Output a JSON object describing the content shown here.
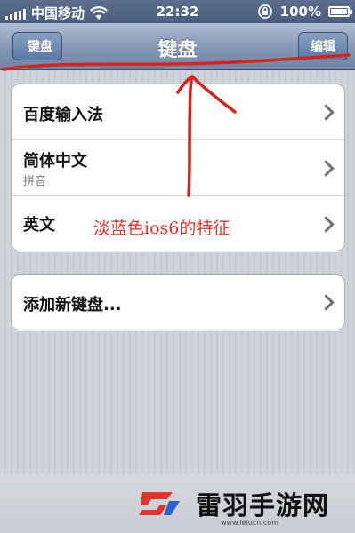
{
  "statusbar": {
    "carrier": "中国移动",
    "time": "22:32",
    "battery": "100%"
  },
  "navbar": {
    "back_label": "键盘",
    "title": "键盘",
    "edit_label": "编辑"
  },
  "keyboards": [
    {
      "label": "百度输入法",
      "sublabel": ""
    },
    {
      "label": "简体中文",
      "sublabel": "拼音"
    },
    {
      "label": "英文",
      "sublabel": ""
    }
  ],
  "add_keyboard": {
    "label": "添加新键盘..."
  },
  "annotation": {
    "text": "淡蓝色ios6的特征",
    "color": "#e0342e"
  },
  "watermark": {
    "name": "雷羽手游网",
    "url": "www.leiucn.com"
  },
  "icons": [
    "signal-icon",
    "wifi-icon",
    "rotation-lock-icon",
    "battery-icon",
    "chevron-right-icon"
  ]
}
